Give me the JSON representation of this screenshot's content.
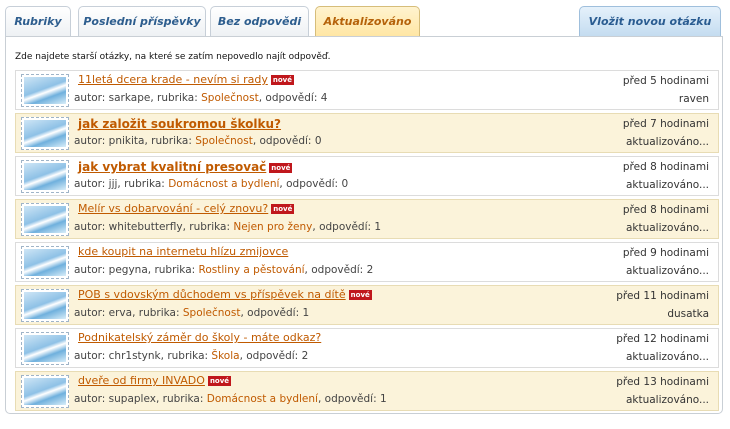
{
  "tabs": [
    {
      "label": "Rubriky",
      "active": false
    },
    {
      "label": "Poslední příspěvky",
      "active": false
    },
    {
      "label": "Bez odpovědi",
      "active": false
    },
    {
      "label": "Aktualizováno",
      "active": true
    }
  ],
  "ask_button": "Vložit novou otázku",
  "intro": "Zde najdete starší otázky, na které se zatím nepovedlo najít odpověď.",
  "labels": {
    "author": "autor:",
    "category": "rubrika:",
    "answers": "odpovědí:",
    "new_badge": "nové"
  },
  "questions": [
    {
      "title": "11letá dcera krade - nevím si rady",
      "is_new": true,
      "author": "sarkape",
      "category": "Společnost",
      "answers": "4",
      "time": "před 5 hodinami",
      "last": "raven",
      "big": false
    },
    {
      "title": "jak založit soukromou školku?",
      "is_new": false,
      "author": "pnikita",
      "category": "Společnost",
      "answers": "0",
      "time": "před 7 hodinami",
      "last": "aktualizováno...",
      "big": true
    },
    {
      "title": "jak vybrat kvalitní presovač",
      "is_new": true,
      "author": "jjj",
      "category": "Domácnost a bydlení",
      "answers": "0",
      "time": "před 8 hodinami",
      "last": "aktualizováno...",
      "big": true
    },
    {
      "title": "Melír vs dobarvování - celý znovu?",
      "is_new": true,
      "author": "whitebutterfly",
      "category": "Nejen pro ženy",
      "answers": "1",
      "time": "před 8 hodinami",
      "last": "aktualizováno...",
      "big": false
    },
    {
      "title": "kde koupit na internetu hlízu zmijovce",
      "is_new": false,
      "author": "pegyna",
      "category": "Rostliny a pěstování",
      "answers": "2",
      "time": "před 9 hodinami",
      "last": "aktualizováno...",
      "big": false
    },
    {
      "title": "POB s vdovským důchodem vs příspěvek na dítě",
      "is_new": true,
      "author": "erva",
      "category": "Společnost",
      "answers": "1",
      "time": "před 11 hodinami",
      "last": "dusatka",
      "big": false
    },
    {
      "title": "Podnikatelský záměr do školy - máte odkaz?",
      "is_new": false,
      "author": "chr1stynk",
      "category": "Škola",
      "answers": "2",
      "time": "před 12 hodinami",
      "last": "aktualizováno...",
      "big": false
    },
    {
      "title": "dveře od firmy INVADO",
      "is_new": true,
      "author": "supaplex",
      "category": "Domácnost a bydlení",
      "answers": "1",
      "time": "před 13 hodinami",
      "last": "aktualizováno...",
      "big": false
    }
  ]
}
